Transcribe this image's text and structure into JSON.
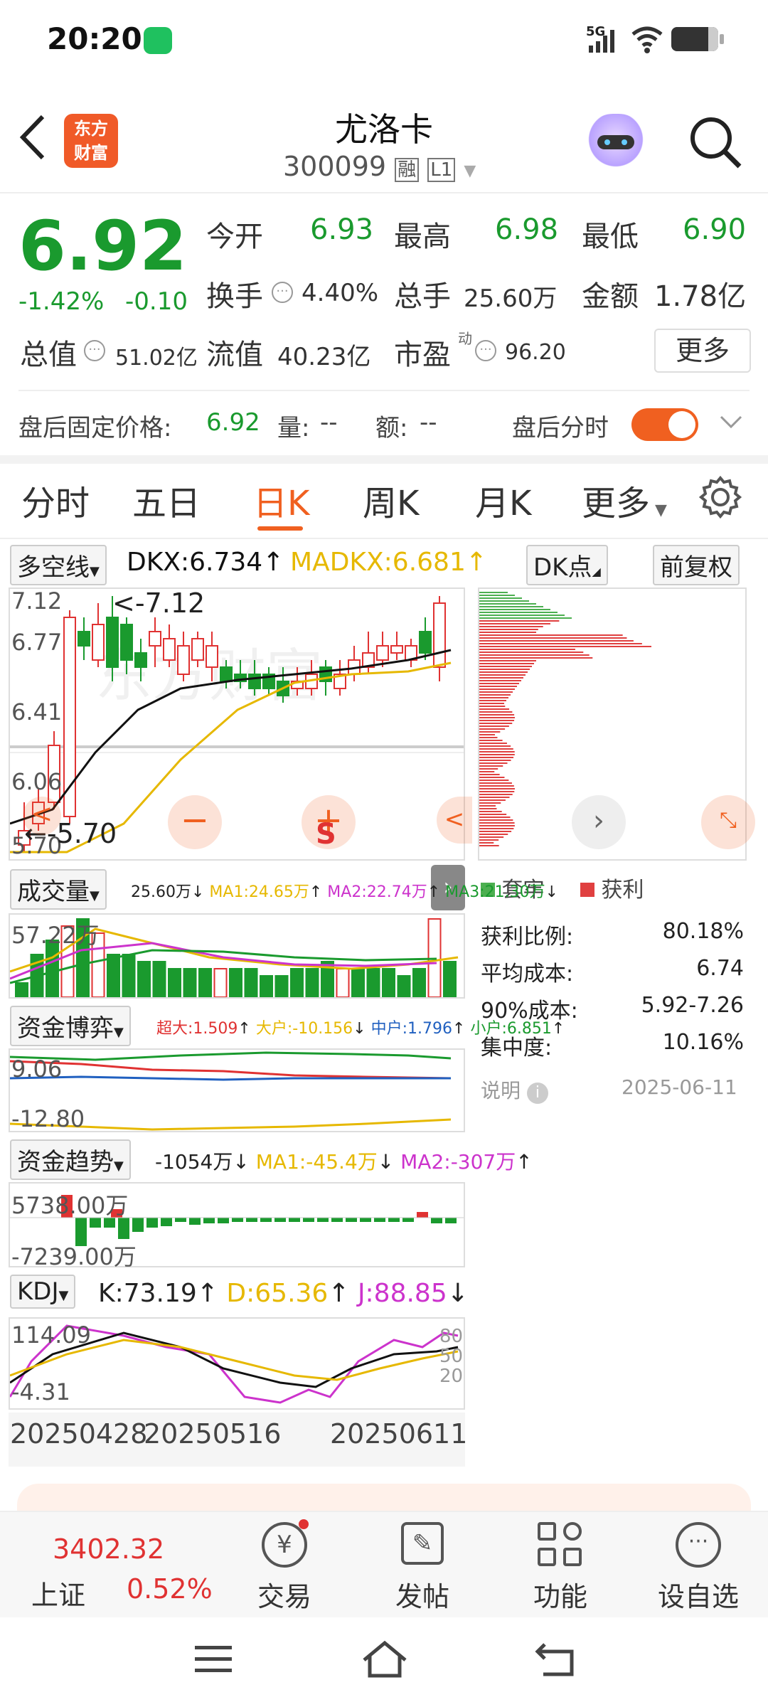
{
  "status_bar": {
    "time": "20:20",
    "network": "5G"
  },
  "header": {
    "title": "尤洛卡",
    "code": "300099",
    "badge1": "融",
    "badge2": "L1",
    "logo": "东方\n财富"
  },
  "quote": {
    "price": "6.92",
    "change_pct": "-1.42%",
    "change": "-0.10",
    "open_label": "今开",
    "open": "6.93",
    "high_label": "最高",
    "high": "6.98",
    "low_label": "最低",
    "low": "6.90",
    "turnover_label": "换手",
    "turnover": "4.40%",
    "volume_label": "总手",
    "volume": "25.60万",
    "amount_label": "金额",
    "amount": "1.78亿",
    "total_cap_label": "总值",
    "total_cap": "51.02亿",
    "float_cap_label": "流值",
    "float_cap": "40.23亿",
    "pe_label": "市盈",
    "pe_sup": "动",
    "pe": "96.20",
    "more": "更多"
  },
  "after_hours": {
    "label": "盘后固定价格:",
    "price": "6.92",
    "vol_label": "量:",
    "vol": "--",
    "amt_label": "额:",
    "amt": "--",
    "switch_label": "盘后分时"
  },
  "tabs": [
    "分时",
    "五日",
    "日K",
    "周K",
    "月K",
    "更多"
  ],
  "kline": {
    "indicator": "多空线",
    "dkx": "DKX:6.734",
    "madkx": "MADKX:6.681",
    "dk_btn": "DK点",
    "adj_btn": "前复权",
    "y_labels": [
      "7.12",
      "6.77",
      "6.41",
      "6.06",
      "5.70"
    ],
    "high_mark": "7.12",
    "low_mark": "5.70",
    "watermark": "东方财富"
  },
  "volume": {
    "label": "成交量",
    "vol": "25.60万",
    "ma1": "MA1:24.65万",
    "ma2": "MA2:22.74万",
    "ma3": "MA3:21.30万",
    "y_label": "57.22万"
  },
  "fund_game": {
    "label": "资金博弈",
    "super": "超大:1.509",
    "big": "大户:-10.156",
    "mid": "中户:1.796",
    "small": "小户:6.851",
    "y_top": "9.06",
    "y_bottom": "-12.80"
  },
  "fund_trend": {
    "label": "资金趋势",
    "val": "-1054万",
    "ma1": "MA1:-45.4万",
    "ma2": "MA2:-307万",
    "y_top": "5738.00万",
    "y_bottom": "-7239.00万"
  },
  "kdj": {
    "label": "KDJ",
    "k": "K:73.19",
    "d": "D:65.36",
    "j": "J:88.85",
    "y_top": "114.09",
    "y_bottom": "-4.31",
    "levels": [
      "80",
      "50",
      "20"
    ],
    "dates": [
      "20250428",
      "20250516",
      "20250611"
    ]
  },
  "chip": {
    "legend_trapped": "套牢",
    "legend_profit": "获利",
    "stats": [
      {
        "label": "获利比例:",
        "value": "80.18%"
      },
      {
        "label": "平均成本:",
        "value": "6.74"
      },
      {
        "label": "90%成本:",
        "value": "5.92-7.26"
      },
      {
        "label": "集中度:",
        "value": "10.16%"
      }
    ],
    "note_label": "说明",
    "date": "2025-06-11"
  },
  "bottom_nav": {
    "index_value": "3402.32",
    "index_name": "上证",
    "index_pct": "0.52%",
    "items": [
      "交易",
      "发帖",
      "功能",
      "设自选"
    ]
  },
  "colors": {
    "up": "#e03232",
    "down": "#1a9a2e",
    "accent": "#f06020"
  }
}
